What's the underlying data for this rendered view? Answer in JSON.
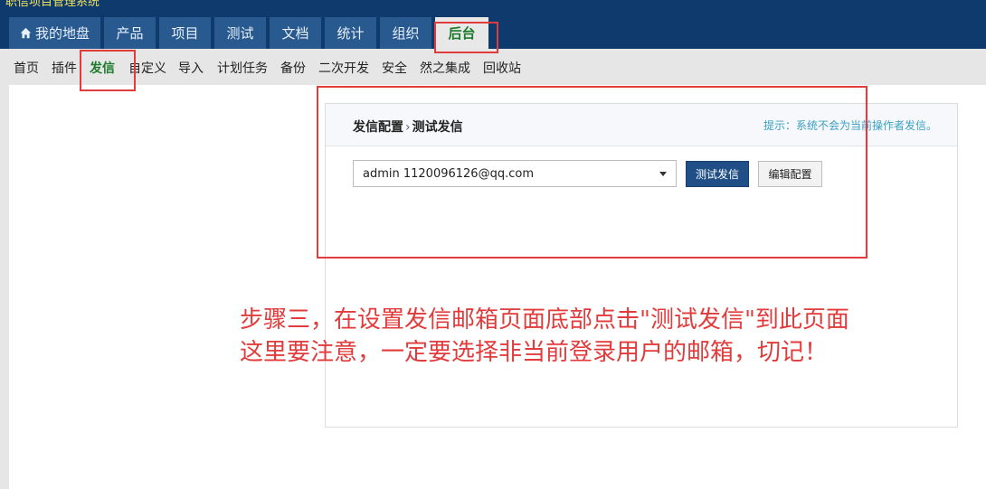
{
  "app": {
    "title": "职信项目管理系统"
  },
  "main_nav": [
    {
      "label": "我的地盘",
      "icon": "home-icon"
    },
    {
      "label": "产品"
    },
    {
      "label": "项目"
    },
    {
      "label": "测试"
    },
    {
      "label": "文档"
    },
    {
      "label": "统计"
    },
    {
      "label": "组织"
    },
    {
      "label": "后台",
      "active": true
    }
  ],
  "sub_nav": [
    {
      "label": "首页"
    },
    {
      "label": "插件"
    },
    {
      "label": "发信",
      "active": true
    },
    {
      "label": "自定义"
    },
    {
      "label": "导入"
    },
    {
      "label": "计划任务"
    },
    {
      "label": "备份"
    },
    {
      "label": "二次开发"
    },
    {
      "label": "安全"
    },
    {
      "label": "然之集成"
    },
    {
      "label": "回收站"
    }
  ],
  "panel": {
    "breadcrumb": {
      "parent": "发信配置",
      "separator": "›",
      "current": "测试发信"
    },
    "tip": "提示：系统不会为当前操作者发信。",
    "recipient_select": {
      "value": "admin 1120096126@qq.com"
    },
    "test_button": "测试发信",
    "edit_button": "编辑配置"
  },
  "annotation": {
    "line1": "步骤三，在设置发信邮箱页面底部点击\"测试发信\"到此页面",
    "line2": "这里要注意，一定要选择非当前登录用户的邮箱，切记！"
  },
  "colors": {
    "topbar": "#0f3a6e",
    "nav_tab": "#285a90",
    "active_text": "#1c7a2a",
    "highlight": "#e23b3b",
    "primary_button": "#1f4f86"
  }
}
